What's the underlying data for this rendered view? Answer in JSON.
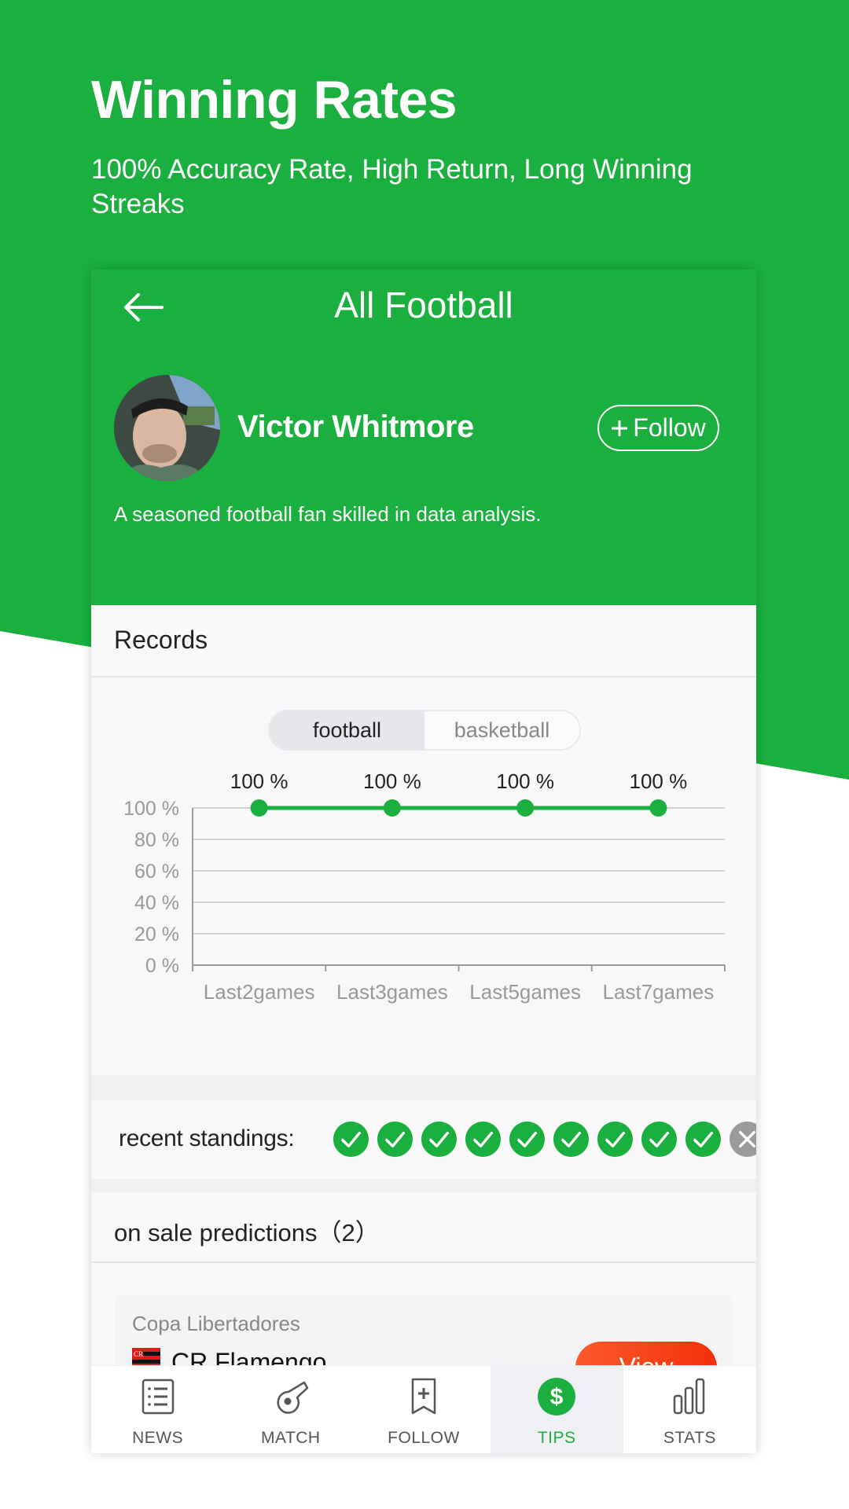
{
  "promo": {
    "title": "Winning Rates",
    "subtitle": "100% Accuracy Rate, High Return, Long Winning Streaks"
  },
  "colors": {
    "brand_green": "#1aaf3e",
    "loss_gray": "#9a9a9a",
    "view_button": "#f5401a",
    "active_tab_bg": "#eff0f3"
  },
  "header": {
    "back_icon": "arrow-left-icon",
    "title": "All Football"
  },
  "profile": {
    "name": "Victor Whitmore",
    "follow_label": "Follow",
    "follow_icon": "plus-icon",
    "bio": "A seasoned football fan skilled in data analysis."
  },
  "records": {
    "title": "Records",
    "segments": [
      {
        "label": "football",
        "active": true
      },
      {
        "label": "basketball",
        "active": false
      }
    ]
  },
  "chart_data": {
    "type": "line",
    "title": "",
    "xlabel": "",
    "ylabel": "",
    "categories": [
      "Last2games",
      "Last3games",
      "Last5games",
      "Last7games"
    ],
    "values": [
      100,
      100,
      100,
      100
    ],
    "data_labels": [
      "100 %",
      "100 %",
      "100 %",
      "100 %"
    ],
    "yticks": [
      "0 %",
      "20 %",
      "40 %",
      "60 %",
      "80 %",
      "100 %"
    ],
    "ylim": [
      0,
      100
    ],
    "grid": true,
    "legend": "none",
    "series_color": "#1aaf3e"
  },
  "standings": {
    "label": "recent standings:",
    "results": [
      "win",
      "win",
      "win",
      "win",
      "win",
      "win",
      "win",
      "win",
      "win",
      "loss"
    ]
  },
  "predictions": {
    "title": "on sale predictions（2）",
    "items": [
      {
        "league": "Copa Libertadores",
        "team": "CR Flamengo",
        "button": "View"
      }
    ]
  },
  "nav": {
    "items": [
      {
        "label": "NEWS",
        "icon": "news-list-icon",
        "active": false
      },
      {
        "label": "MATCH",
        "icon": "whistle-icon",
        "active": false
      },
      {
        "label": "FOLLOW",
        "icon": "bookmark-plus-icon",
        "active": false
      },
      {
        "label": "TIPS",
        "icon": "dollar-circle-icon",
        "active": true
      },
      {
        "label": "STATS",
        "icon": "bar-chart-icon",
        "active": false
      }
    ]
  }
}
